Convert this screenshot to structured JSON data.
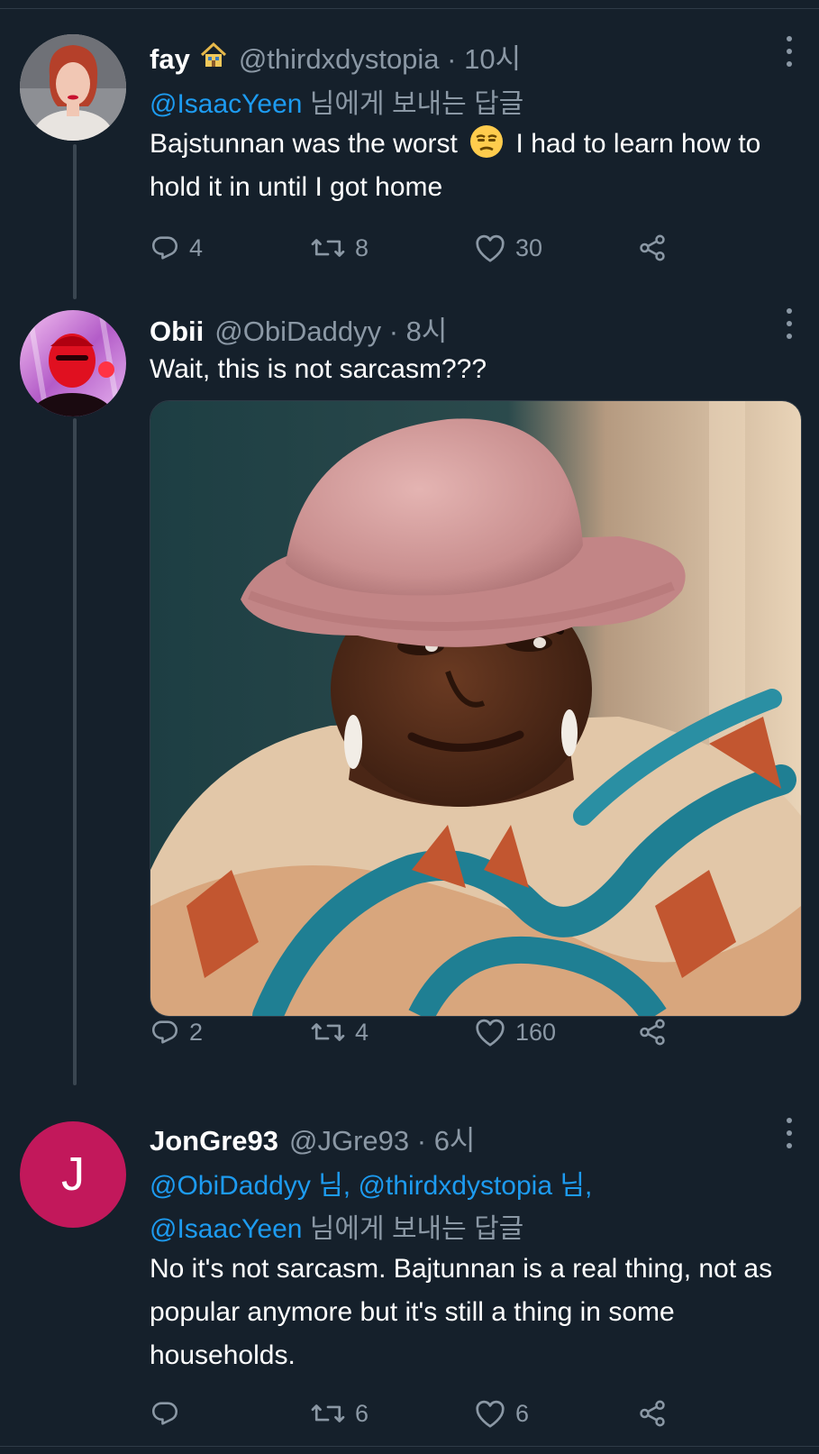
{
  "tweets": [
    {
      "name": "fay",
      "handle": "@thirdxdystopia · 10시",
      "reply_mention": "@IsaacYeen",
      "reply_suffix": " 님에게 보내는 답글",
      "text_before_emoji": "Bajstunnan was the worst ",
      "text_after_emoji": " I had to learn how to hold it in until I got home",
      "emoji": "unamused-face",
      "replies": "4",
      "retweets": "8",
      "likes": "30"
    },
    {
      "name": "Obii",
      "handle": "@ObiDaddyy · 8시",
      "text": "Wait, this is not sarcasm???",
      "media_description": "woman-in-pink-fur-hat-side-eye",
      "replies": "2",
      "retweets": "4",
      "likes": "160"
    },
    {
      "name": "JonGre93",
      "handle": "@JGre93 · 6시",
      "avatar_letter": "J",
      "avatar_color": "#c2185b",
      "reply_mention_1": "@ObiDaddyy",
      "reply_sep_1": " 님, ",
      "reply_mention_2": "@thirdxdystopia",
      "reply_sep_2": " 님,",
      "reply_mention_3": "@IsaacYeen",
      "reply_suffix": " 님에게 보내는 답글",
      "text": "No it's not sarcasm. Bajtunnan is a real thing, not as popular anymore but it's still a thing in some households.",
      "replies": "",
      "retweets": "6",
      "likes": "6"
    }
  ],
  "icons": [
    "home-icon",
    "more-icon",
    "reply-icon",
    "retweet-icon",
    "like-icon",
    "share-icon"
  ],
  "colors": {
    "background": "#15202b",
    "link": "#1d9bf0",
    "secondary_text": "#8b98a5"
  }
}
